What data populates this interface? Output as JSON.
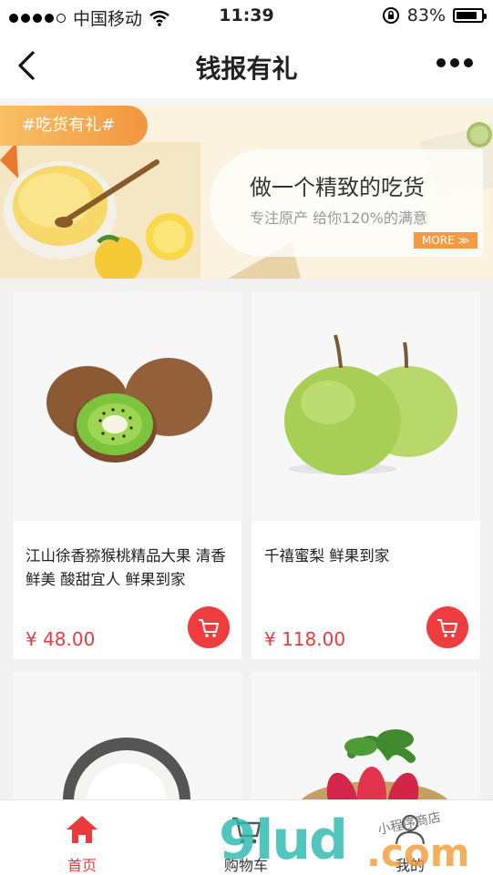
{
  "status_bar": {
    "carrier": "中国移动",
    "time": "11:39",
    "battery": "83%",
    "battery_level": 0.83
  },
  "nav": {
    "title": "钱报有礼"
  },
  "banner": {
    "tag": "#吃货有礼#",
    "headline": "做一个精致的吃货",
    "subline": "专注原产  给你120%的满意",
    "more": "MORE ≫"
  },
  "products": [
    {
      "name": "江山徐香猕猴桃精品大果 清香鲜美 酸甜宜人 鲜果到家",
      "price": "¥ 48.00",
      "image": "kiwi-image"
    },
    {
      "name": "千禧蜜梨 鲜果到家",
      "price": "¥ 118.00",
      "image": "pear-image"
    },
    {
      "name": "",
      "price": "",
      "image": "rice-image"
    },
    {
      "name": "",
      "price": "",
      "image": "sweet-potato-image"
    }
  ],
  "tabs": [
    {
      "label": "首页",
      "icon": "home-icon",
      "active": true
    },
    {
      "label": "购物车",
      "icon": "cart-icon",
      "active": false
    },
    {
      "label": "我的",
      "icon": "user-icon",
      "active": false
    }
  ],
  "watermark": {
    "text": "9lud",
    "suffix": ".com",
    "small": "小程序商店"
  },
  "colors": {
    "accent": "#e93b3d",
    "orange": "#f39a45"
  }
}
